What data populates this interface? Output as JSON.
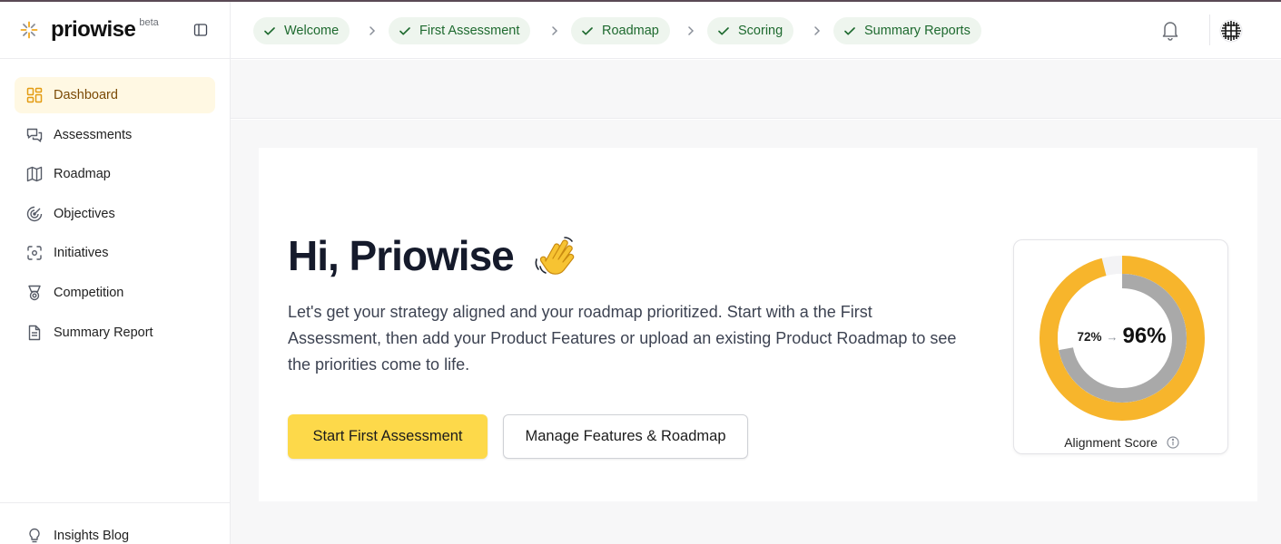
{
  "brand": {
    "name": "priowise",
    "badge": "beta"
  },
  "sidebar": {
    "items": [
      {
        "label": "Dashboard",
        "icon": "grid-icon",
        "active": true
      },
      {
        "label": "Assessments",
        "icon": "chat-bubbles-icon",
        "active": false
      },
      {
        "label": "Roadmap",
        "icon": "map-icon",
        "active": false
      },
      {
        "label": "Objectives",
        "icon": "target-icon",
        "active": false
      },
      {
        "label": "Initiatives",
        "icon": "focus-icon",
        "active": false
      },
      {
        "label": "Competition",
        "icon": "medal-icon",
        "active": false
      },
      {
        "label": "Summary Report",
        "icon": "document-icon",
        "active": false
      }
    ],
    "footer": {
      "label": "Insights Blog",
      "icon": "lightbulb-icon"
    }
  },
  "steps": [
    {
      "label": "Welcome",
      "done": true
    },
    {
      "label": "First Assessment",
      "done": true
    },
    {
      "label": "Roadmap",
      "done": true
    },
    {
      "label": "Scoring",
      "done": true
    },
    {
      "label": "Summary Reports",
      "done": true
    }
  ],
  "hero": {
    "greeting": "Hi, Priowise",
    "intro": "Let's get your strategy aligned and your roadmap prioritized. Start with a the First Assessment, then add your Product Features or upload an existing Product Roadmap to see the priorities come to life.",
    "primary_button": "Start First Assessment",
    "secondary_button": "Manage Features & Roadmap"
  },
  "score": {
    "from_label": "72%",
    "arrow": "→",
    "to_label": "96%",
    "from_value": 0.72,
    "to_value": 0.96,
    "label": "Alignment Score"
  },
  "colors": {
    "accent": "#fdd94a",
    "ring_outer": "#f7b52c",
    "ring_inner": "#a9a9a9",
    "step_bg": "#eef5ee",
    "step_text": "#1e6a2f",
    "active_nav_bg": "#fff8e3"
  }
}
